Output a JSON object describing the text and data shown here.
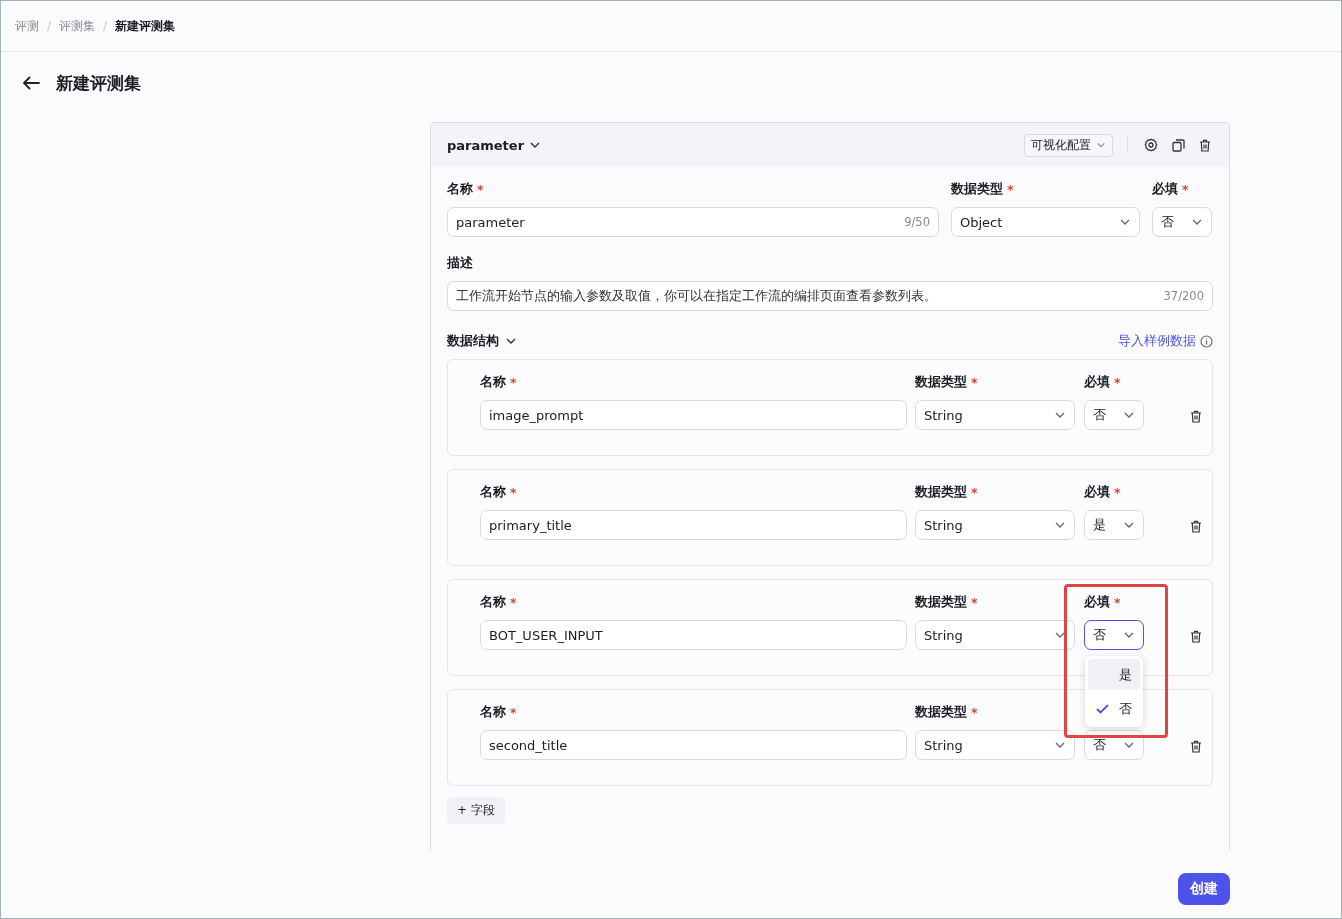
{
  "breadcrumb": [
    {
      "label": "评测",
      "current": false
    },
    {
      "label": "评测集",
      "current": false
    },
    {
      "label": "新建评测集",
      "current": true
    }
  ],
  "breadcrumb_separator": "/",
  "page_title": "新建评测集",
  "panel": {
    "name": "parameter",
    "mode_select": "可视化配置",
    "name_label": {
      "text": "名称",
      "required_mark": "*"
    },
    "name_value": "parameter",
    "name_counter": "9/50",
    "type_label": {
      "text": "数据类型",
      "required_mark": "*"
    },
    "type_value": "Object",
    "required_label": {
      "text": "必填",
      "required_mark": "*"
    },
    "required_value": "否",
    "description_label": "描述",
    "description_value": "工作流开始节点的输入参数及取值，你可以在指定工作流的编排页面查看参数列表。",
    "description_counter": "37/200",
    "structure_label": "数据结构",
    "import_link": "导入样例数据",
    "fields": [
      {
        "name_label": {
          "text": "名称",
          "required_mark": "*"
        },
        "name_value": "image_prompt",
        "type_label": {
          "text": "数据类型",
          "required_mark": "*"
        },
        "type_value": "String",
        "required_label": {
          "text": "必填",
          "required_mark": "*"
        },
        "required_value": "否",
        "open": false,
        "highlighted": false
      },
      {
        "name_label": {
          "text": "名称",
          "required_mark": "*"
        },
        "name_value": "primary_title",
        "type_label": {
          "text": "数据类型",
          "required_mark": "*"
        },
        "type_value": "String",
        "required_label": {
          "text": "必填",
          "required_mark": "*"
        },
        "required_value": "是",
        "open": false,
        "highlighted": false
      },
      {
        "name_label": {
          "text": "名称",
          "required_mark": "*"
        },
        "name_value": "BOT_USER_INPUT",
        "type_label": {
          "text": "数据类型",
          "required_mark": "*"
        },
        "type_value": "String",
        "required_label": {
          "text": "必填",
          "required_mark": "*"
        },
        "required_value": "否",
        "open": true,
        "highlighted": true,
        "options": [
          {
            "label": "是",
            "selected": false,
            "hovered": true
          },
          {
            "label": "否",
            "selected": true,
            "hovered": false
          }
        ]
      },
      {
        "name_label": {
          "text": "名称",
          "required_mark": "*"
        },
        "name_value": "second_title",
        "type_label": {
          "text": "数据类型",
          "required_mark": "*"
        },
        "type_value": "String",
        "required_value": "否",
        "open": false,
        "highlighted": false
      }
    ],
    "add_field_icon": "+",
    "add_field_label": "字段"
  },
  "create_button": "创建"
}
